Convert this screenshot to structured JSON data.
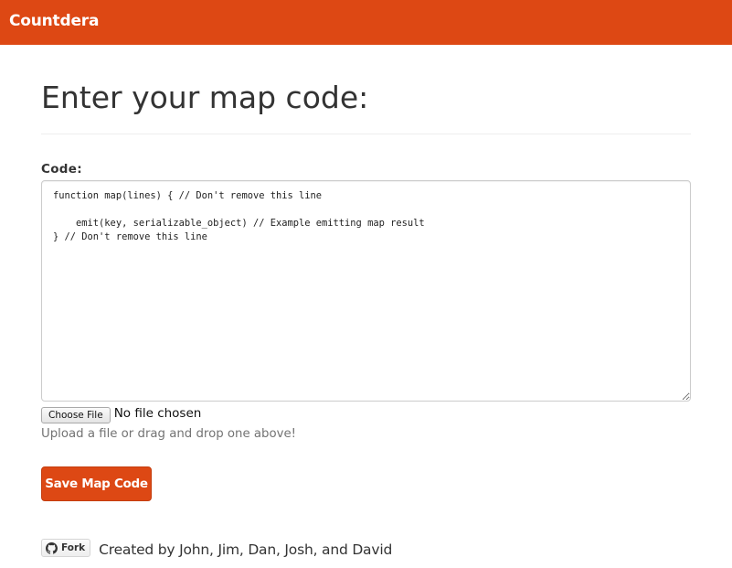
{
  "navbar": {
    "brand": "Countdera",
    "color": "#dd4814"
  },
  "main": {
    "title": "Enter your map code:",
    "code_label": "Code:",
    "code_value": "function map(lines) { // Don't remove this line\n\n    emit(key, serializable_object) // Example emitting map result\n} // Don't remove this line",
    "file_button_label": "Choose File",
    "file_status": "No file chosen",
    "help_text": "Upload a file or drag and drop one above!",
    "save_label": "Save Map Code",
    "accent_color": "#dd4814"
  },
  "footer": {
    "fork_label": "Fork",
    "fork_icon": "github-icon",
    "credits": "Created by John, Jim, Dan, Josh, and David"
  }
}
